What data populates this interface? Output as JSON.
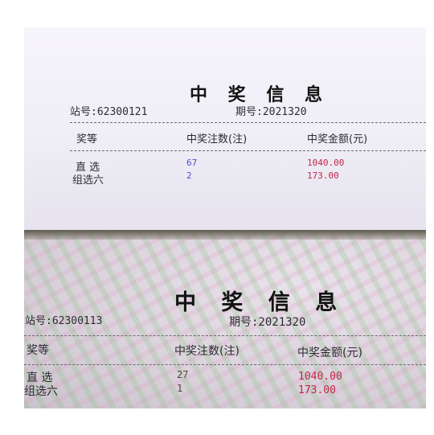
{
  "photo_top": {
    "title": "中 奖 信 息",
    "station": "站号:62300121",
    "period": "期号:2021320",
    "headers": [
      "奖等",
      "中奖注数(注)",
      "中奖金额(元)"
    ],
    "rows": [
      {
        "level": "直 选",
        "count": "67",
        "amount": "1040.00"
      },
      {
        "level": "组选六",
        "count": "2",
        "amount": "173.00"
      }
    ]
  },
  "photo_bottom": {
    "title": "中 奖 信 息",
    "station": "站号:62300113",
    "period": "期号:2021320",
    "headers": [
      "奖等",
      "中奖注数(注)",
      "中奖金额(元)"
    ],
    "rows": [
      {
        "level": "直 选",
        "count": "27",
        "amount": "1040.00"
      },
      {
        "level": "组选六",
        "count": "1",
        "amount": "173.00"
      }
    ]
  },
  "colors": {
    "count_text": "#4a52c8",
    "amount_text": "#c2294a"
  }
}
